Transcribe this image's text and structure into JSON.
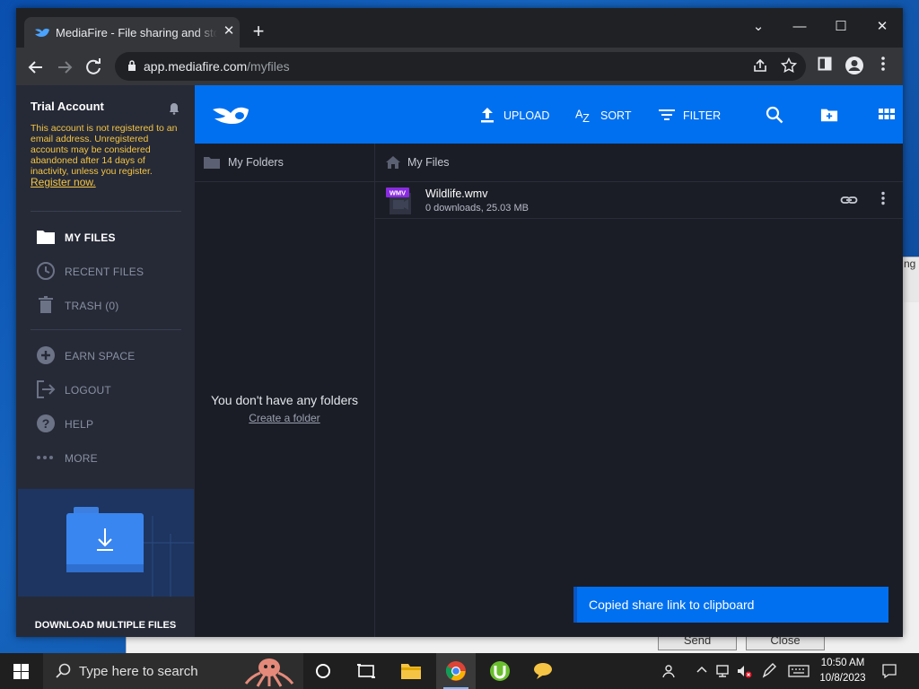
{
  "browser": {
    "tab_title": "MediaFire - File sharing and storage",
    "tab_close": "✕",
    "new_tab": "+",
    "url_host": "app.mediafire.com",
    "url_path": "/myfiles",
    "window_controls": {
      "minimize": "—",
      "restore": "☐",
      "close": "✕",
      "tab_search": "⌄"
    }
  },
  "sidebar": {
    "account_title": "Trial Account",
    "warning_text": "This account is not registered to an email address. Unregistered accounts may be considered abandoned after 14 days of inactivity, unless you register.",
    "register_link": "Register now.",
    "nav_items": [
      {
        "label": "MY FILES",
        "icon": "folder-icon",
        "active": true
      },
      {
        "label": "RECENT FILES",
        "icon": "clock-icon",
        "active": false
      },
      {
        "label": "TRASH (0)",
        "icon": "trash-icon",
        "active": false
      },
      {
        "label": "EARN SPACE",
        "icon": "plus-circle-icon",
        "active": false
      },
      {
        "label": "LOGOUT",
        "icon": "logout-icon",
        "active": false
      },
      {
        "label": "HELP",
        "icon": "help-icon",
        "active": false
      },
      {
        "label": "MORE",
        "icon": "more-icon",
        "active": false
      }
    ],
    "promo_label": "DOWNLOAD MULTIPLE FILES"
  },
  "topbar": {
    "upload_label": "UPLOAD",
    "sort_label": "SORT",
    "filter_label": "FILTER"
  },
  "folders": {
    "header": "My Folders",
    "empty_text": "You don't have any folders",
    "create_link": "Create a folder"
  },
  "files": {
    "header": "My Files",
    "items": [
      {
        "name": "Wildlife.wmv",
        "meta": "0 downloads, 25.03 MB",
        "badge": "WMV"
      }
    ]
  },
  "toast": {
    "message": "Copied share link to clipboard"
  },
  "background_dialog": {
    "send": "Send",
    "close": "Close",
    "side_text": "ng"
  },
  "taskbar": {
    "search_placeholder": "Type here to search",
    "time": "10:50 AM",
    "date": "10/8/2023"
  },
  "colors": {
    "brand_blue": "#0070f0",
    "sidebar_bg": "#262a37",
    "content_bg": "#1b1d26",
    "warning": "#f5c542"
  }
}
